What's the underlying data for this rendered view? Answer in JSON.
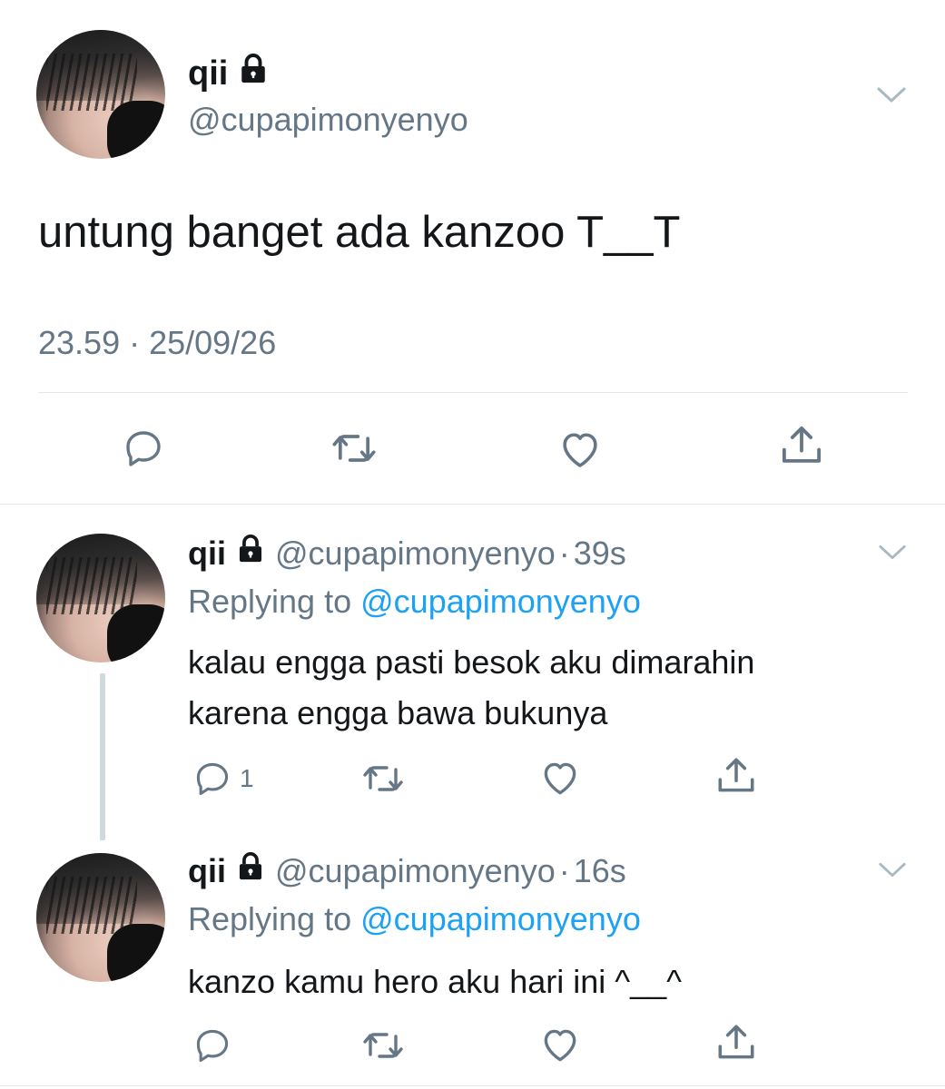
{
  "main_tweet": {
    "display_name": "qii",
    "handle": "@cupapimonyenyo",
    "text": "untung banget ada kanzoo T__T",
    "timestamp": "23.59 · 25/09/26"
  },
  "replies": [
    {
      "display_name": "qii",
      "handle": "@cupapimonyenyo",
      "time_sep": "·",
      "time": "39s",
      "replying_label": "Replying to",
      "replying_to": "@cupapimonyenyo",
      "text_line1": "kalau engga pasti besok aku dimarahin",
      "text_line2": "karena engga bawa bukunya",
      "reply_count": "1"
    },
    {
      "display_name": "qii",
      "handle": "@cupapimonyenyo",
      "time_sep": "·",
      "time": "16s",
      "replying_label": "Replying to",
      "replying_to": "@cupapimonyenyo",
      "text_line1": "kanzo kamu hero aku hari ini ^__^",
      "reply_count": ""
    }
  ],
  "icons": [
    "lock-icon",
    "chevron-down-icon",
    "reply-icon",
    "retweet-icon",
    "like-icon",
    "share-icon"
  ],
  "colors": {
    "text": "#14171a",
    "muted": "#657786",
    "link": "#1da1f2",
    "divider": "#e1e8ed"
  }
}
